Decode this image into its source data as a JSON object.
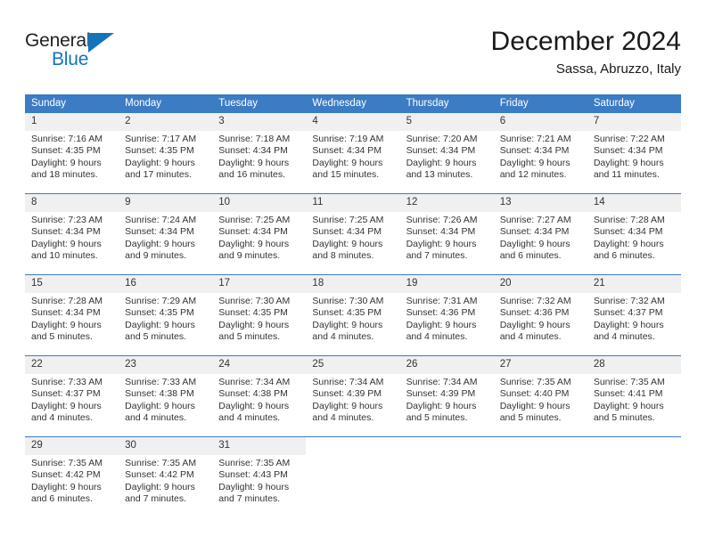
{
  "brand": {
    "name_top": "General",
    "name_bottom": "Blue",
    "color_dark": "#231f20",
    "color_blue": "#1275bc"
  },
  "header": {
    "title": "December 2024",
    "subtitle": "Sassa, Abruzzo, Italy"
  },
  "theme": {
    "header_bg": "#3b7cc4",
    "daynum_bg": "#f0f0f0",
    "grid_line": "#3b7cc4",
    "text": "#333333"
  },
  "calendar": {
    "weekday_headers": [
      "Sunday",
      "Monday",
      "Tuesday",
      "Wednesday",
      "Thursday",
      "Friday",
      "Saturday"
    ],
    "weeks": [
      [
        {
          "day": "1",
          "sunrise": "Sunrise: 7:16 AM",
          "sunset": "Sunset: 4:35 PM",
          "daylight1": "Daylight: 9 hours",
          "daylight2": "and 18 minutes."
        },
        {
          "day": "2",
          "sunrise": "Sunrise: 7:17 AM",
          "sunset": "Sunset: 4:35 PM",
          "daylight1": "Daylight: 9 hours",
          "daylight2": "and 17 minutes."
        },
        {
          "day": "3",
          "sunrise": "Sunrise: 7:18 AM",
          "sunset": "Sunset: 4:34 PM",
          "daylight1": "Daylight: 9 hours",
          "daylight2": "and 16 minutes."
        },
        {
          "day": "4",
          "sunrise": "Sunrise: 7:19 AM",
          "sunset": "Sunset: 4:34 PM",
          "daylight1": "Daylight: 9 hours",
          "daylight2": "and 15 minutes."
        },
        {
          "day": "5",
          "sunrise": "Sunrise: 7:20 AM",
          "sunset": "Sunset: 4:34 PM",
          "daylight1": "Daylight: 9 hours",
          "daylight2": "and 13 minutes."
        },
        {
          "day": "6",
          "sunrise": "Sunrise: 7:21 AM",
          "sunset": "Sunset: 4:34 PM",
          "daylight1": "Daylight: 9 hours",
          "daylight2": "and 12 minutes."
        },
        {
          "day": "7",
          "sunrise": "Sunrise: 7:22 AM",
          "sunset": "Sunset: 4:34 PM",
          "daylight1": "Daylight: 9 hours",
          "daylight2": "and 11 minutes."
        }
      ],
      [
        {
          "day": "8",
          "sunrise": "Sunrise: 7:23 AM",
          "sunset": "Sunset: 4:34 PM",
          "daylight1": "Daylight: 9 hours",
          "daylight2": "and 10 minutes."
        },
        {
          "day": "9",
          "sunrise": "Sunrise: 7:24 AM",
          "sunset": "Sunset: 4:34 PM",
          "daylight1": "Daylight: 9 hours",
          "daylight2": "and 9 minutes."
        },
        {
          "day": "10",
          "sunrise": "Sunrise: 7:25 AM",
          "sunset": "Sunset: 4:34 PM",
          "daylight1": "Daylight: 9 hours",
          "daylight2": "and 9 minutes."
        },
        {
          "day": "11",
          "sunrise": "Sunrise: 7:25 AM",
          "sunset": "Sunset: 4:34 PM",
          "daylight1": "Daylight: 9 hours",
          "daylight2": "and 8 minutes."
        },
        {
          "day": "12",
          "sunrise": "Sunrise: 7:26 AM",
          "sunset": "Sunset: 4:34 PM",
          "daylight1": "Daylight: 9 hours",
          "daylight2": "and 7 minutes."
        },
        {
          "day": "13",
          "sunrise": "Sunrise: 7:27 AM",
          "sunset": "Sunset: 4:34 PM",
          "daylight1": "Daylight: 9 hours",
          "daylight2": "and 6 minutes."
        },
        {
          "day": "14",
          "sunrise": "Sunrise: 7:28 AM",
          "sunset": "Sunset: 4:34 PM",
          "daylight1": "Daylight: 9 hours",
          "daylight2": "and 6 minutes."
        }
      ],
      [
        {
          "day": "15",
          "sunrise": "Sunrise: 7:28 AM",
          "sunset": "Sunset: 4:34 PM",
          "daylight1": "Daylight: 9 hours",
          "daylight2": "and 5 minutes."
        },
        {
          "day": "16",
          "sunrise": "Sunrise: 7:29 AM",
          "sunset": "Sunset: 4:35 PM",
          "daylight1": "Daylight: 9 hours",
          "daylight2": "and 5 minutes."
        },
        {
          "day": "17",
          "sunrise": "Sunrise: 7:30 AM",
          "sunset": "Sunset: 4:35 PM",
          "daylight1": "Daylight: 9 hours",
          "daylight2": "and 5 minutes."
        },
        {
          "day": "18",
          "sunrise": "Sunrise: 7:30 AM",
          "sunset": "Sunset: 4:35 PM",
          "daylight1": "Daylight: 9 hours",
          "daylight2": "and 4 minutes."
        },
        {
          "day": "19",
          "sunrise": "Sunrise: 7:31 AM",
          "sunset": "Sunset: 4:36 PM",
          "daylight1": "Daylight: 9 hours",
          "daylight2": "and 4 minutes."
        },
        {
          "day": "20",
          "sunrise": "Sunrise: 7:32 AM",
          "sunset": "Sunset: 4:36 PM",
          "daylight1": "Daylight: 9 hours",
          "daylight2": "and 4 minutes."
        },
        {
          "day": "21",
          "sunrise": "Sunrise: 7:32 AM",
          "sunset": "Sunset: 4:37 PM",
          "daylight1": "Daylight: 9 hours",
          "daylight2": "and 4 minutes."
        }
      ],
      [
        {
          "day": "22",
          "sunrise": "Sunrise: 7:33 AM",
          "sunset": "Sunset: 4:37 PM",
          "daylight1": "Daylight: 9 hours",
          "daylight2": "and 4 minutes."
        },
        {
          "day": "23",
          "sunrise": "Sunrise: 7:33 AM",
          "sunset": "Sunset: 4:38 PM",
          "daylight1": "Daylight: 9 hours",
          "daylight2": "and 4 minutes."
        },
        {
          "day": "24",
          "sunrise": "Sunrise: 7:34 AM",
          "sunset": "Sunset: 4:38 PM",
          "daylight1": "Daylight: 9 hours",
          "daylight2": "and 4 minutes."
        },
        {
          "day": "25",
          "sunrise": "Sunrise: 7:34 AM",
          "sunset": "Sunset: 4:39 PM",
          "daylight1": "Daylight: 9 hours",
          "daylight2": "and 4 minutes."
        },
        {
          "day": "26",
          "sunrise": "Sunrise: 7:34 AM",
          "sunset": "Sunset: 4:39 PM",
          "daylight1": "Daylight: 9 hours",
          "daylight2": "and 5 minutes."
        },
        {
          "day": "27",
          "sunrise": "Sunrise: 7:35 AM",
          "sunset": "Sunset: 4:40 PM",
          "daylight1": "Daylight: 9 hours",
          "daylight2": "and 5 minutes."
        },
        {
          "day": "28",
          "sunrise": "Sunrise: 7:35 AM",
          "sunset": "Sunset: 4:41 PM",
          "daylight1": "Daylight: 9 hours",
          "daylight2": "and 5 minutes."
        }
      ],
      [
        {
          "day": "29",
          "sunrise": "Sunrise: 7:35 AM",
          "sunset": "Sunset: 4:42 PM",
          "daylight1": "Daylight: 9 hours",
          "daylight2": "and 6 minutes."
        },
        {
          "day": "30",
          "sunrise": "Sunrise: 7:35 AM",
          "sunset": "Sunset: 4:42 PM",
          "daylight1": "Daylight: 9 hours",
          "daylight2": "and 7 minutes."
        },
        {
          "day": "31",
          "sunrise": "Sunrise: 7:35 AM",
          "sunset": "Sunset: 4:43 PM",
          "daylight1": "Daylight: 9 hours",
          "daylight2": "and 7 minutes."
        },
        {
          "day": "",
          "sunrise": "",
          "sunset": "",
          "daylight1": "",
          "daylight2": ""
        },
        {
          "day": "",
          "sunrise": "",
          "sunset": "",
          "daylight1": "",
          "daylight2": ""
        },
        {
          "day": "",
          "sunrise": "",
          "sunset": "",
          "daylight1": "",
          "daylight2": ""
        },
        {
          "day": "",
          "sunrise": "",
          "sunset": "",
          "daylight1": "",
          "daylight2": ""
        }
      ]
    ]
  }
}
